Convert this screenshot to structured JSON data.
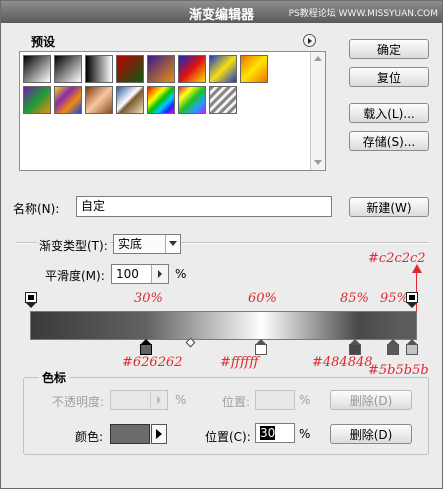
{
  "window": {
    "title": "渐变编辑器",
    "watermark": "PS教程论坛 WWW.MISSYUAN.COM"
  },
  "presets": {
    "label": "预设",
    "swatches": [
      {
        "name": "fg-to-bg",
        "css": "linear-gradient(135deg,#000 0%,#fff 100%)"
      },
      {
        "name": "fg-to-transparent",
        "css": "linear-gradient(135deg,#000 0%,rgba(0,0,0,0) 100%)"
      },
      {
        "name": "black-white",
        "css": "linear-gradient(90deg,#000 0%,#fff 100%)"
      },
      {
        "name": "red-green",
        "css": "linear-gradient(135deg,#c00000 0%,#0a5a14 100%)"
      },
      {
        "name": "violet-orange",
        "css": "linear-gradient(135deg,#3a1a8a 0%,#e89010 100%)"
      },
      {
        "name": "blue-red-yellow",
        "css": "linear-gradient(135deg,#1428c8 0%,#e01010 50%,#f8e000 100%)"
      },
      {
        "name": "blue-yellow-blue",
        "css": "linear-gradient(135deg,#1a3acc 0%,#f8e010 50%,#1a3acc 100%)"
      },
      {
        "name": "orange-yellow-orange",
        "css": "linear-gradient(135deg,#f07000 0%,#ffe600 50%,#f07000 100%)"
      },
      {
        "name": "violet-green-orange",
        "css": "linear-gradient(135deg,#7a1aa8 0%,#1a9a3a 50%,#f08a10 100%)"
      },
      {
        "name": "yellow-violet-orange-blue",
        "css": "linear-gradient(135deg,#f8d800 0%,#8a2ab0 35%,#f08a10 65%,#1848d8 100%)"
      },
      {
        "name": "copper",
        "css": "linear-gradient(135deg,#7a3a10 0%,#f8c8a0 50%,#8a4a20 100%)"
      },
      {
        "name": "chrome",
        "css": "linear-gradient(135deg,#2a5aa8 0%,#ffffff 45%,#7a5a30 55%,#f0e0c0 100%)"
      },
      {
        "name": "spectrum",
        "css": "linear-gradient(135deg,#ff0000 0%,#ff8800 17%,#ffff00 33%,#00c000 50%,#00c8ff 67%,#2020ff 83%,#ff00ff 100%)"
      },
      {
        "name": "transparent-rainbow",
        "css": "linear-gradient(135deg,#ff2020 0%,#ffff20 25%,#20c020 50%,#20a0ff 75%,#c020ff 100%)"
      },
      {
        "name": "transparent-stripes",
        "css": "repeating-linear-gradient(135deg,#888 0px,#888 3px,#f4f4f4 3px,#f4f4f4 6px)"
      }
    ]
  },
  "buttons": {
    "ok": "确定",
    "reset": "复位",
    "load": "载入(L)...",
    "save": "存储(S)...",
    "new": "新建(W)"
  },
  "name": {
    "label": "名称(N):",
    "value": "自定"
  },
  "gradient_type": {
    "label": "渐变类型(T):",
    "value": "实底"
  },
  "smoothness": {
    "label": "平滑度(M):",
    "value": "100",
    "unit": "%"
  },
  "annotations": {
    "top_color": "#c2c2c2",
    "percents": [
      "30%",
      "60%",
      "85%",
      "95%"
    ],
    "bottom_colors": [
      "#626262",
      "#ffffff",
      "#484848",
      "#5b5b5b"
    ]
  },
  "color_stops": {
    "section_label": "色标",
    "opacity_label": "不透明度:",
    "opacity_unit": "%",
    "position_label_top": "位置:",
    "position_unit_top": "%",
    "delete_label_top": "删除(D)",
    "color_label": "颜色:",
    "color_value": "#6b6b6b",
    "position_label": "位置(C):",
    "position_value": "30",
    "position_unit": "%",
    "delete_label": "删除(D)"
  }
}
